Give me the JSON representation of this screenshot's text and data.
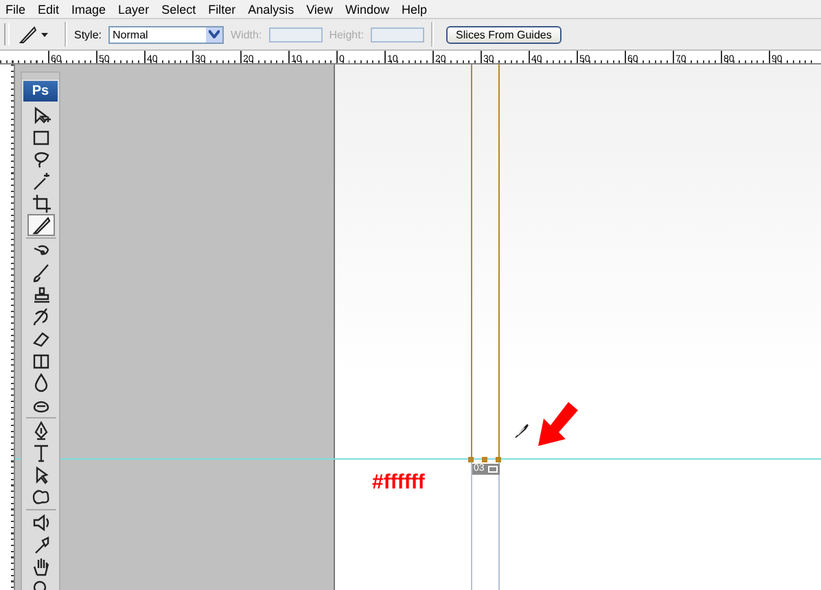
{
  "menu": [
    "File",
    "Edit",
    "Image",
    "Layer",
    "Select",
    "Filter",
    "Analysis",
    "View",
    "Window",
    "Help"
  ],
  "options": {
    "style_label": "Style:",
    "style_value": "Normal",
    "width": {
      "label": "Width:",
      "disabled": true
    },
    "height": {
      "label": "Height:",
      "disabled": true
    },
    "button": "Slices From Guides"
  },
  "ruler": {
    "labels": [
      "60",
      "50",
      "40",
      "30",
      "20",
      "10",
      "0",
      "10",
      "20",
      "30",
      "40",
      "50",
      "60",
      "70",
      "80",
      "90"
    ]
  },
  "toolbox": {
    "logo": "Ps",
    "tools": [
      {
        "selected": false
      },
      {
        "selected": false
      },
      {
        "selected": false
      },
      {
        "selected": false
      },
      {
        "selected": false
      },
      {
        "selected": true
      },
      {
        "selected": false
      },
      {
        "selected": false
      },
      {
        "selected": false
      },
      {
        "selected": false
      },
      {
        "selected": false
      },
      {
        "selected": false
      },
      {
        "selected": false
      },
      {
        "selected": false
      },
      {
        "selected": false
      },
      {
        "selected": false
      },
      {
        "selected": false
      },
      {
        "selected": false
      },
      {
        "selected": false
      },
      {
        "selected": false
      },
      {
        "selected": false
      },
      {
        "selected": false
      }
    ]
  },
  "canvas": {
    "slice_number": "03",
    "annotation": "#ffffff"
  }
}
